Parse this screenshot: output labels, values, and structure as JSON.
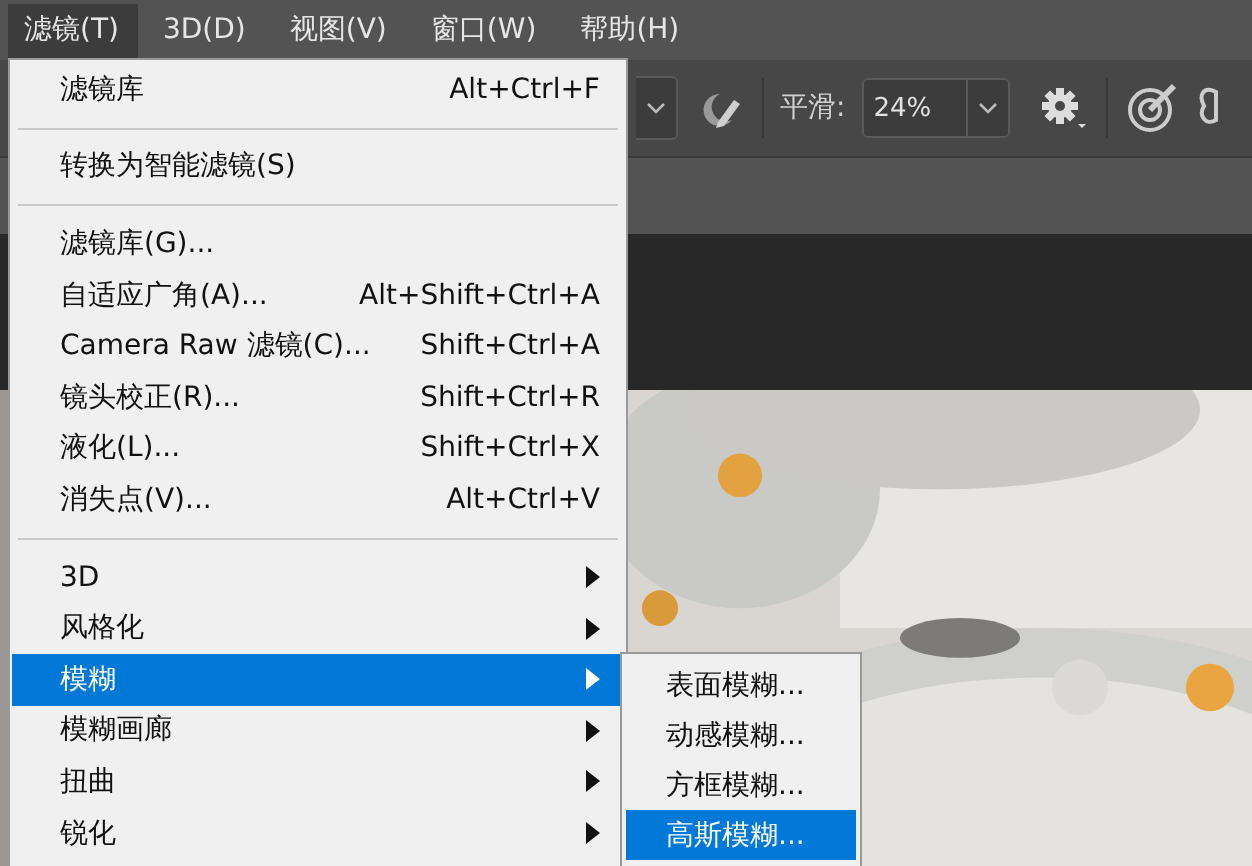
{
  "menu_bar": [
    {
      "label": "滤镜(T)",
      "selected": true
    },
    {
      "label": "3D(D)",
      "selected": false
    },
    {
      "label": "视图(V)",
      "selected": false
    },
    {
      "label": "窗口(W)",
      "selected": false
    },
    {
      "label": "帮助(H)",
      "selected": false
    }
  ],
  "options_bar": {
    "smoothing_label": "平滑:",
    "smoothing_value": "24%"
  },
  "filter_menu": [
    {
      "kind": "item",
      "label": "滤镜库",
      "shortcut": "Alt+Ctrl+F",
      "submenu": false,
      "selected": false
    },
    {
      "kind": "separator"
    },
    {
      "kind": "item",
      "label": "转换为智能滤镜(S)",
      "submenu": false,
      "selected": false
    },
    {
      "kind": "separator"
    },
    {
      "kind": "item",
      "label": "滤镜库(G)...",
      "submenu": false,
      "selected": false
    },
    {
      "kind": "item",
      "label": "自适应广角(A)...",
      "shortcut": "Alt+Shift+Ctrl+A",
      "submenu": false,
      "selected": false
    },
    {
      "kind": "item",
      "label": "Camera Raw 滤镜(C)...",
      "shortcut": "Shift+Ctrl+A",
      "submenu": false,
      "selected": false
    },
    {
      "kind": "item",
      "label": "镜头校正(R)...",
      "shortcut": "Shift+Ctrl+R",
      "submenu": false,
      "selected": false
    },
    {
      "kind": "item",
      "label": "液化(L)...",
      "shortcut": "Shift+Ctrl+X",
      "submenu": false,
      "selected": false
    },
    {
      "kind": "item",
      "label": "消失点(V)...",
      "shortcut": "Alt+Ctrl+V",
      "submenu": false,
      "selected": false
    },
    {
      "kind": "separator"
    },
    {
      "kind": "item",
      "label": "3D",
      "submenu": true,
      "selected": false
    },
    {
      "kind": "item",
      "label": "风格化",
      "submenu": true,
      "selected": false
    },
    {
      "kind": "item",
      "label": "模糊",
      "submenu": true,
      "selected": true
    },
    {
      "kind": "item",
      "label": "模糊画廊",
      "submenu": true,
      "selected": false
    },
    {
      "kind": "item",
      "label": "扭曲",
      "submenu": true,
      "selected": false
    },
    {
      "kind": "item",
      "label": "锐化",
      "submenu": true,
      "selected": false
    }
  ],
  "blur_submenu": [
    {
      "label": "表面模糊...",
      "selected": false
    },
    {
      "label": "动感模糊...",
      "selected": false
    },
    {
      "label": "方框模糊...",
      "selected": false
    },
    {
      "label": "高斯模糊...",
      "selected": true
    }
  ]
}
